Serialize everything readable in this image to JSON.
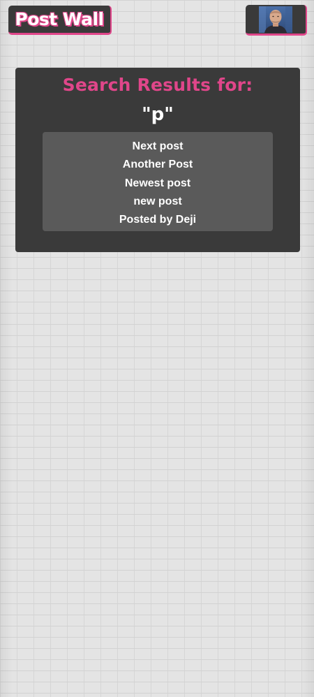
{
  "header": {
    "logo_text": "Post Wall",
    "avatar_alt": "user-avatar"
  },
  "search": {
    "heading": "Search Results for:",
    "query": "\"p\"",
    "results": [
      "Next post",
      "Another Post",
      "Newest post",
      "new post",
      "Posted by Deji"
    ]
  },
  "colors": {
    "accent": "#e0468a",
    "panel": "#3a3a3a",
    "list_bg": "#5a5a5a",
    "wall": "#e4e4e4"
  }
}
